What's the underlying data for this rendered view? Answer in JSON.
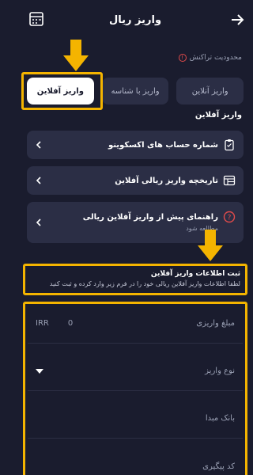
{
  "header": {
    "title": "واریز ریال"
  },
  "limit": {
    "label": "محدودیت تراکنش",
    "icon": "info-icon"
  },
  "tabs": [
    {
      "label": "واریز آنلاین"
    },
    {
      "label": "واریز با شناسه"
    },
    {
      "label": "واریز آفلاین"
    }
  ],
  "section_label": "واریز آفلاین",
  "cards": [
    {
      "label": "شماره حساب های اکسکوینو",
      "icon": "clipboard-icon"
    },
    {
      "label": "تاریخچه واریز ریالی آفلاین",
      "icon": "history-table-icon"
    },
    {
      "label": "راهنمای پیش از واریز آفلاین ریالی",
      "sub": "مطالعه شود",
      "icon": "help-icon"
    }
  ],
  "info": {
    "title": "ثبت اطلاعات واریز آفلاین",
    "desc": "لطفا اطلاعات واریز آفلاین ریالی خود را در فرم زیر وارد کرده و ثبت کنید"
  },
  "form": {
    "amount_label": "مبلغ واریزی",
    "amount_value": "0",
    "amount_currency": "IRR",
    "type_label": "نوع واریز",
    "bank_label": "بانک مبدا",
    "tracking_label": "کد پیگیری"
  },
  "colors": {
    "background": "#1a1c2e",
    "card": "#2b2e45",
    "highlight": "#f4b400",
    "danger": "#e04b4b"
  }
}
